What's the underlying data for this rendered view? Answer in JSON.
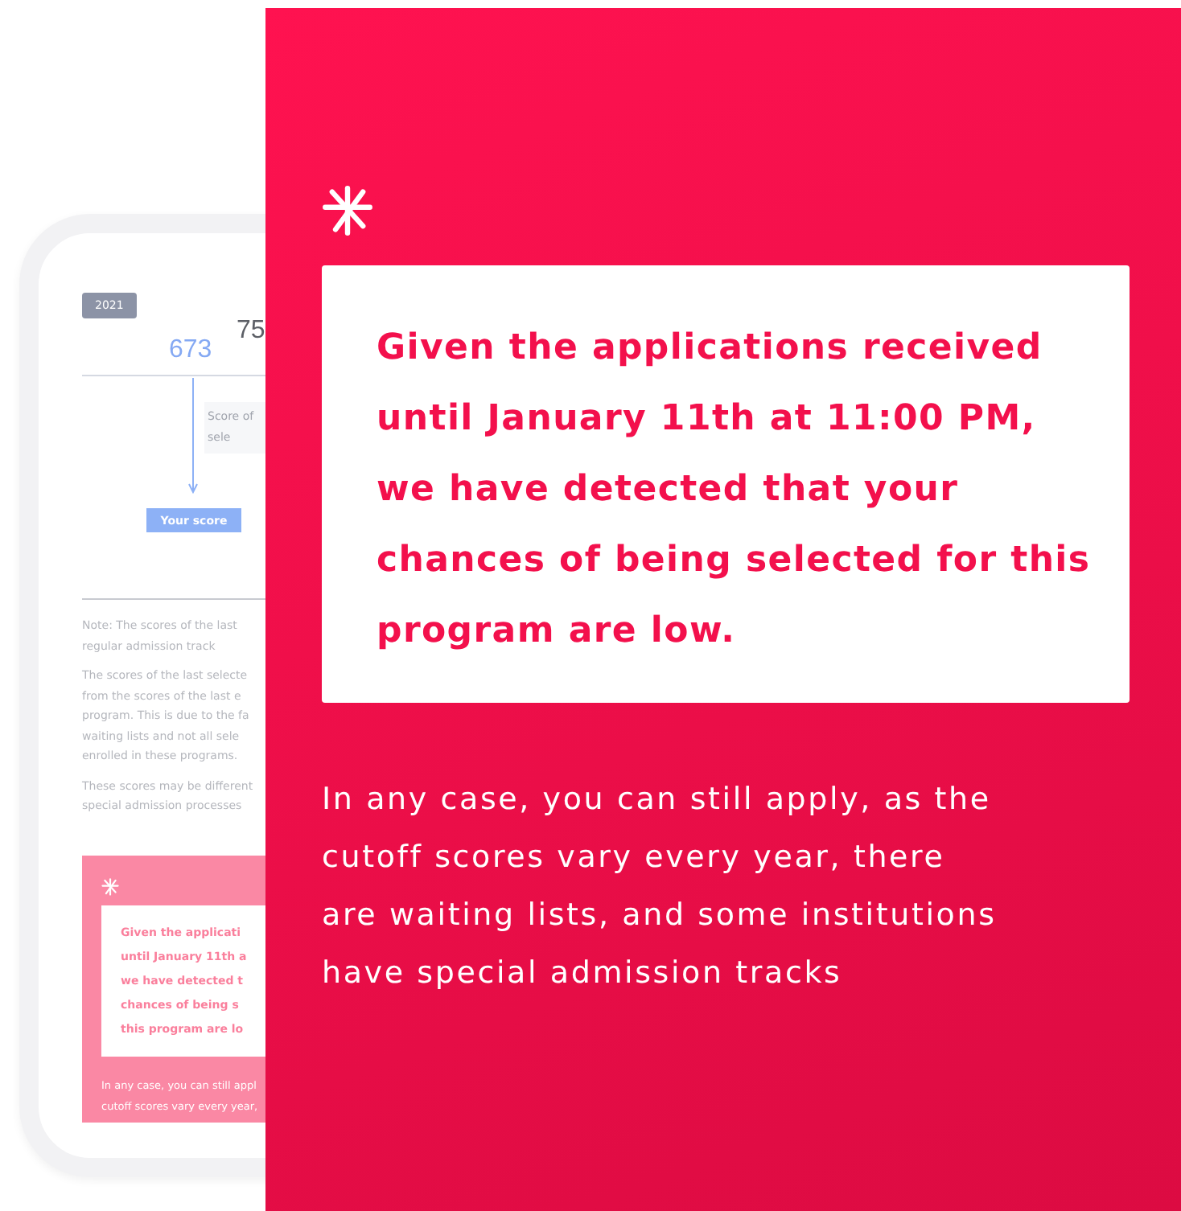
{
  "phone": {
    "year_badge": "2021",
    "your_score_value": "673",
    "last_selected_value": "75",
    "last_selected_label": [
      "Score of",
      "sele"
    ],
    "your_score_label": "Your score",
    "notes": [
      [
        "Note: The scores of the last",
        "regular admission track"
      ],
      [
        "The scores of the last selecte",
        "from the scores of the last e",
        "program. This is due to the fa",
        "waiting lists and not all sele",
        "enrolled in these programs."
      ],
      [
        "These scores may be different",
        "special admission processes"
      ]
    ],
    "alert_card": {
      "message": [
        "Given the applicati",
        "until January 11th a",
        "we have detected t",
        "chances of being s",
        "this program are lo"
      ],
      "footer": [
        "In any case, you can still appl",
        "cutoff scores vary every year,"
      ]
    }
  },
  "panel": {
    "message": "Given the applications received until January 11th at 11:00 PM, we have detected that your chances of being selected for this program are low.",
    "footer": "In any case, you can still apply, as the cutoff scores vary every year, there are waiting lists, and some institutions have special admission tracks"
  }
}
